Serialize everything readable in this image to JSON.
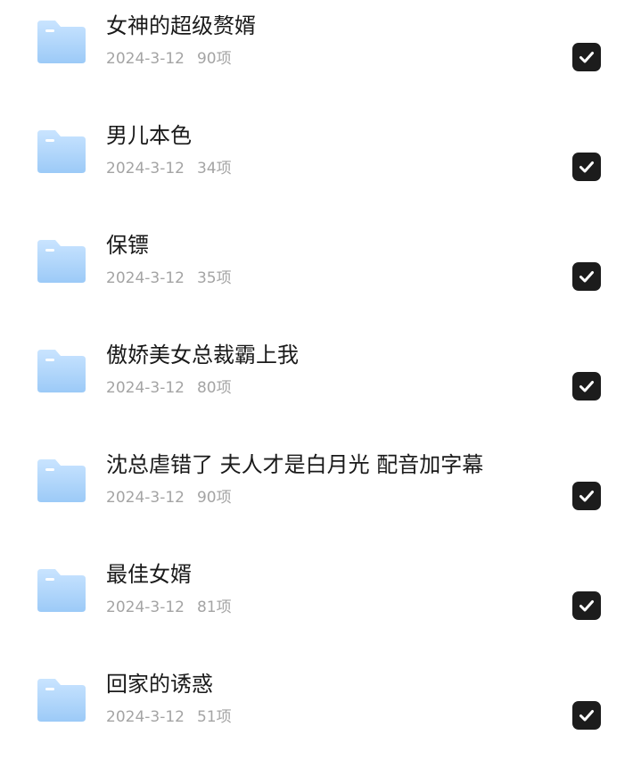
{
  "colors": {
    "folder_light": "#c9e4ff",
    "folder_dark": "#9ccaf7",
    "title": "#1a1a1a",
    "meta": "#a4a4a4",
    "checkbox": "#1c1c1c"
  },
  "items": [
    {
      "title": "女神的超级赘婿",
      "date": "2024-3-12",
      "count": "90项",
      "checked": true
    },
    {
      "title": "男儿本色",
      "date": "2024-3-12",
      "count": "34项",
      "checked": true
    },
    {
      "title": "保镖",
      "date": "2024-3-12",
      "count": "35项",
      "checked": true
    },
    {
      "title": "傲娇美女总裁霸上我",
      "date": "2024-3-12",
      "count": "80项",
      "checked": true
    },
    {
      "title": "沈总虐错了 夫人才是白月光 配音加字幕",
      "date": "2024-3-12",
      "count": "90项",
      "checked": true
    },
    {
      "title": "最佳女婿",
      "date": "2024-3-12",
      "count": "81项",
      "checked": true
    },
    {
      "title": "回家的诱惑",
      "date": "2024-3-12",
      "count": "51项",
      "checked": true
    }
  ]
}
